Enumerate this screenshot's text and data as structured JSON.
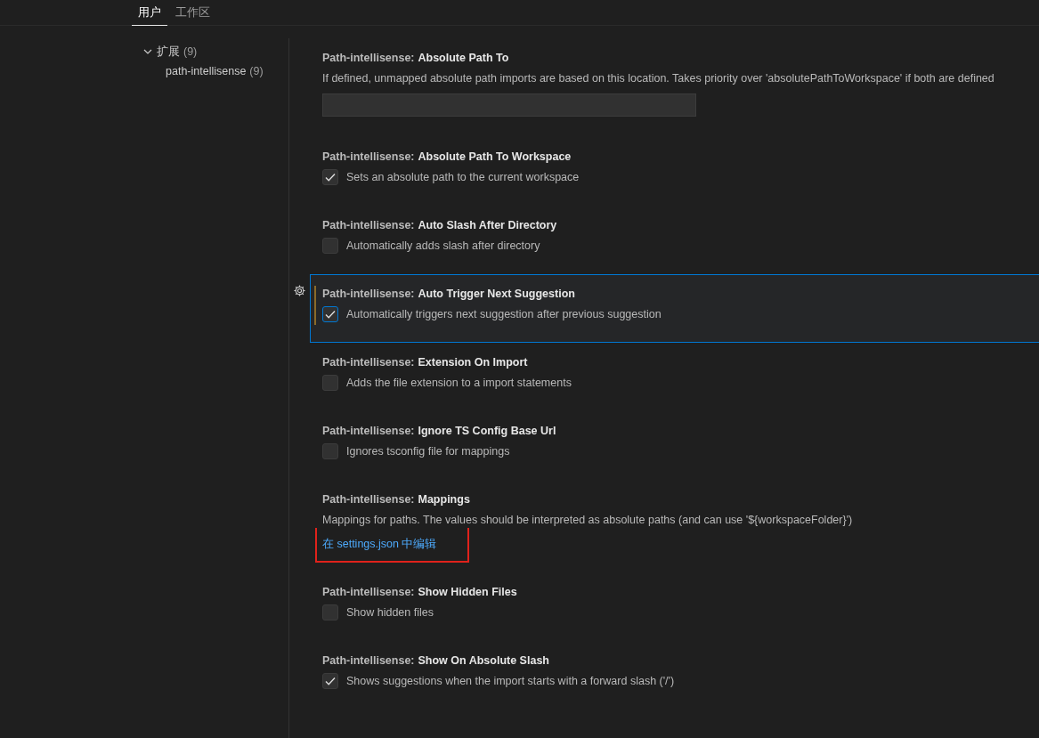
{
  "tabs": [
    {
      "label": "用户",
      "selected": true
    },
    {
      "label": "工作区",
      "selected": false
    }
  ],
  "tree": [
    {
      "label": "扩展",
      "count": "(9)",
      "expanded": true,
      "children": [
        {
          "label": "path-intellisense",
          "count": "(9)"
        }
      ]
    }
  ],
  "settings": [
    {
      "kind": "text",
      "category": "Path-intellisense:",
      "name": "Absolute Path To",
      "description": "If defined, unmapped absolute path imports are based on this location. Takes priority over 'absolutePathToWorkspace' if both are defined",
      "focused": false,
      "modified": false
    },
    {
      "kind": "checkbox",
      "category": "Path-intellisense:",
      "name": "Absolute Path To Workspace",
      "description": "Sets an absolute path to the current workspace",
      "checked": true,
      "focused": false,
      "modified": false
    },
    {
      "kind": "checkbox",
      "category": "Path-intellisense:",
      "name": "Auto Slash After Directory",
      "description": "Automatically adds slash after directory",
      "checked": false,
      "focused": false,
      "modified": false
    },
    {
      "kind": "checkbox",
      "category": "Path-intellisense:",
      "name": "Auto Trigger Next Suggestion",
      "description": "Automatically triggers next suggestion after previous suggestion",
      "checked": true,
      "focused": true,
      "modified": true
    },
    {
      "kind": "checkbox",
      "category": "Path-intellisense:",
      "name": "Extension On Import",
      "description": "Adds the file extension to a import statements",
      "checked": false,
      "focused": false,
      "modified": false
    },
    {
      "kind": "checkbox",
      "category": "Path-intellisense:",
      "name": "Ignore TS Config Base Url",
      "description": "Ignores tsconfig file for mappings",
      "checked": false,
      "focused": false,
      "modified": false
    },
    {
      "kind": "link",
      "category": "Path-intellisense:",
      "name": "Mappings",
      "description": "Mappings for paths. The values should be interpreted as absolute paths (and can use '${workspaceFolder}')",
      "link": "在 settings.json 中编辑",
      "focused": false,
      "modified": false
    },
    {
      "kind": "checkbox",
      "category": "Path-intellisense:",
      "name": "Show Hidden Files",
      "description": "Show hidden files",
      "checked": false,
      "focused": false,
      "modified": false
    },
    {
      "kind": "checkbox",
      "category": "Path-intellisense:",
      "name": "Show On Absolute Slash",
      "description": "Shows suggestions when the import starts with a forward slash ('/')",
      "checked": true,
      "focused": false,
      "modified": false
    }
  ]
}
